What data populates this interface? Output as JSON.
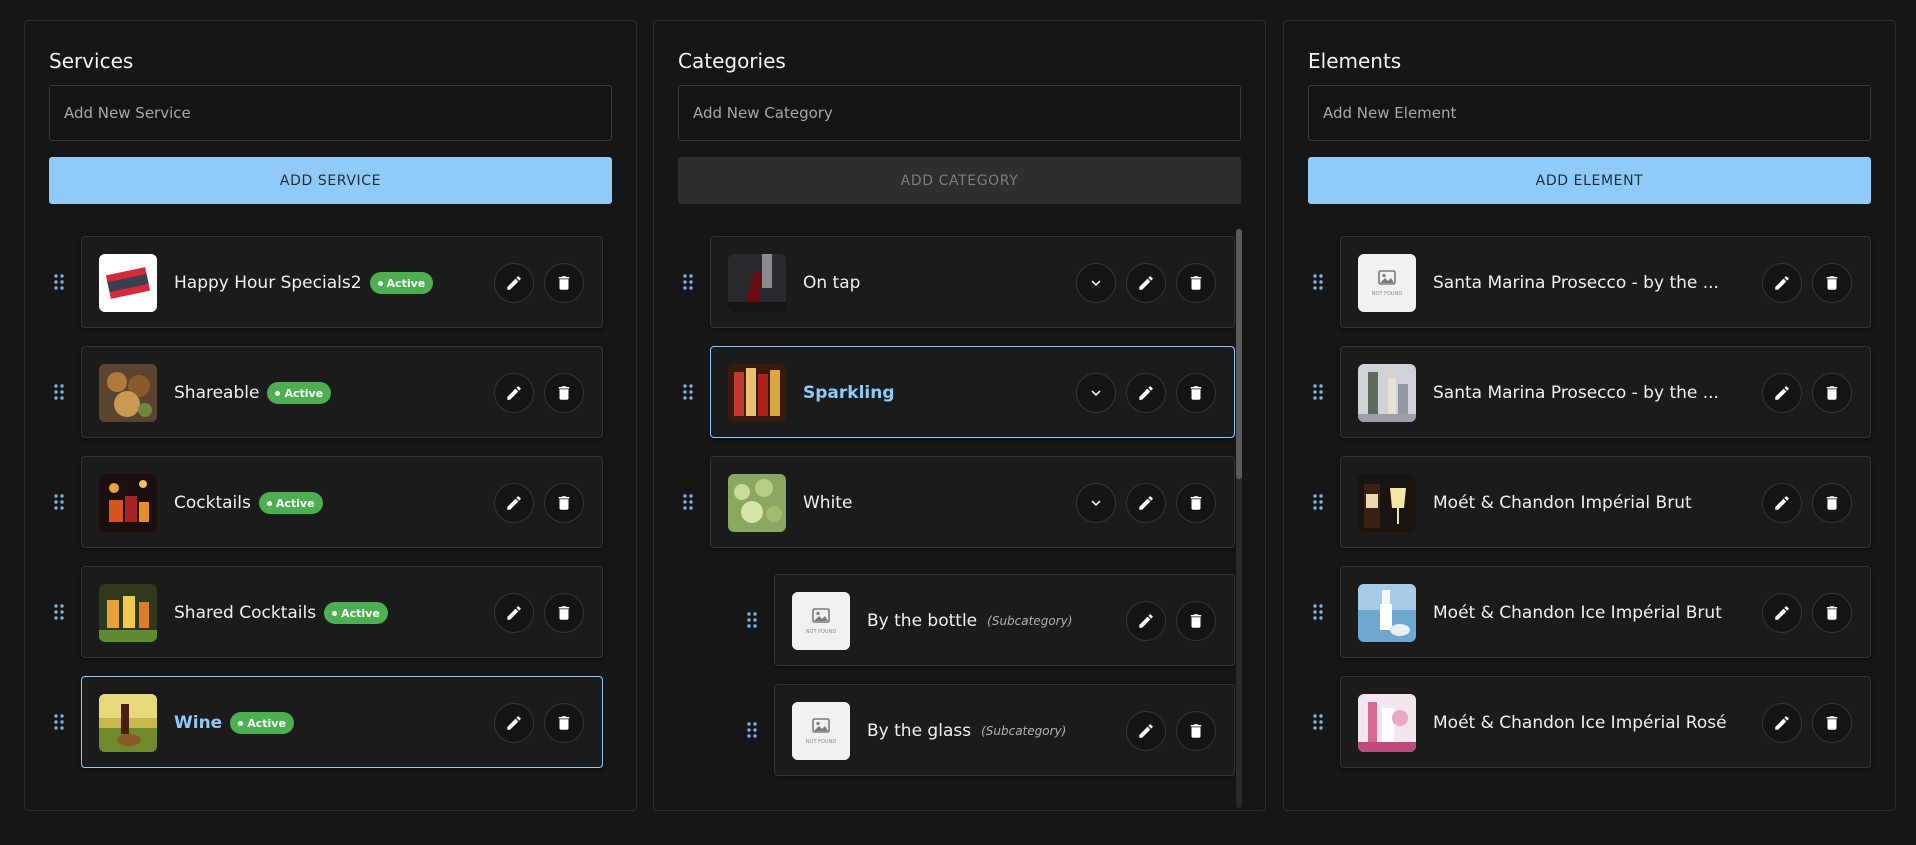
{
  "services": {
    "title": "Services",
    "input_placeholder": "Add New Service",
    "button_label": "ADD SERVICE",
    "items": [
      {
        "name": "Happy Hour Specials2",
        "status": "Active"
      },
      {
        "name": "Shareable",
        "status": "Active"
      },
      {
        "name": "Cocktails",
        "status": "Active"
      },
      {
        "name": "Shared Cocktails",
        "status": "Active"
      },
      {
        "name": "Wine",
        "status": "Active"
      }
    ]
  },
  "categories": {
    "title": "Categories",
    "input_placeholder": "Add New Category",
    "button_label": "ADD CATEGORY",
    "items": [
      {
        "name": "On tap"
      },
      {
        "name": "Sparkling"
      },
      {
        "name": "White"
      },
      {
        "name": "By the bottle",
        "tag": "(Subcategory)"
      },
      {
        "name": "By the glass",
        "tag": "(Subcategory)"
      }
    ]
  },
  "elements": {
    "title": "Elements",
    "input_placeholder": "Add New Element",
    "button_label": "ADD ELEMENT",
    "items": [
      {
        "name": "Santa Marina Prosecco - by the ..."
      },
      {
        "name": "Santa Marina Prosecco - by the ..."
      },
      {
        "name": "Moét & Chandon Impérial Brut"
      },
      {
        "name": "Moét & Chandon Ice Impérial Brut"
      },
      {
        "name": "Moét & Chandon Ice Impérial Rosé"
      }
    ]
  },
  "icons": {
    "drag": "drag-handle-icon",
    "edit": "pencil-icon",
    "delete": "trash-icon",
    "expand": "chevron-down-icon",
    "placeholder_image": "image-not-found-icon"
  },
  "placeholder_image_text": "NOT FOUND",
  "colors": {
    "accent": "#90caf9",
    "active_badge": "#4caf50",
    "background": "#161616",
    "card": "#1b1b1b"
  }
}
